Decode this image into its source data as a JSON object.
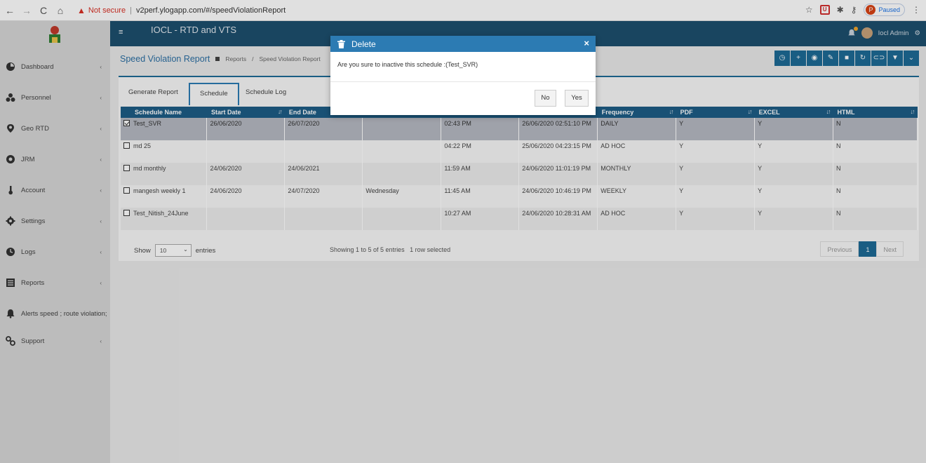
{
  "browser": {
    "not_secure": "Not secure",
    "url": "v2perf.ylogapp.com/#/speedViolationReport",
    "paused_label": "Paused",
    "profile_letter": "P"
  },
  "header": {
    "app_title": "IOCL - RTD and VTS",
    "user_name": "Iocl Admin"
  },
  "sidebar": {
    "items": [
      {
        "label": "Dashboard"
      },
      {
        "label": "Personnel"
      },
      {
        "label": "Geo RTD"
      },
      {
        "label": "JRM"
      },
      {
        "label": "Account"
      },
      {
        "label": "Settings"
      },
      {
        "label": "Logs"
      },
      {
        "label": "Reports"
      },
      {
        "label": "Alerts speed ; route violation;"
      },
      {
        "label": "Support"
      }
    ]
  },
  "page": {
    "title": "Speed Violation Report",
    "crumb_reports": "Reports",
    "crumb_current": "Speed Violation Report"
  },
  "tabs": [
    "Generate Report",
    "Schedule",
    "Schedule Log"
  ],
  "table": {
    "headers": [
      "Schedule Name",
      "Start Date",
      "End Date",
      "",
      "",
      "",
      "Frequency",
      "PDF",
      "EXCEL",
      "HTML"
    ],
    "rows": [
      [
        "Test_SVR",
        "26/06/2020",
        "26/07/2020",
        "",
        "02:43 PM",
        "26/06/2020 02:51:10 PM",
        "DAILY",
        "Y",
        "Y",
        "N"
      ],
      [
        "md 25",
        "",
        "",
        "",
        "04:22 PM",
        "25/06/2020 04:23:15 PM",
        "AD HOC",
        "Y",
        "Y",
        "N"
      ],
      [
        "md monthly",
        "24/06/2020",
        "24/06/2021",
        "",
        "11:59 AM",
        "24/06/2020 11:01:19 PM",
        "MONTHLY",
        "Y",
        "Y",
        "N"
      ],
      [
        "mangesh weekly 1",
        "24/06/2020",
        "24/07/2020",
        "Wednesday",
        "11:45 AM",
        "24/06/2020 10:46:19 PM",
        "WEEKLY",
        "Y",
        "Y",
        "N"
      ],
      [
        "Test_Nitish_24June",
        "",
        "",
        "",
        "10:27 AM",
        "24/06/2020 10:28:31 AM",
        "AD HOC",
        "Y",
        "Y",
        "N"
      ]
    ]
  },
  "footer": {
    "show": "Show",
    "entries_value": "10",
    "entries": "entries",
    "info": "Showing 1 to 5 of 5 entries",
    "selected": "1 row selected",
    "previous": "Previous",
    "page": "1",
    "next": "Next"
  },
  "modal": {
    "title": "Delete",
    "message": "Are you sure to inactive this schedule :(Test_SVR)",
    "no": "No",
    "yes": "Yes"
  },
  "colors": {
    "header_bg": "#1d4f6e",
    "accent": "#1d6a96",
    "modal_head": "#2c7bb3"
  }
}
